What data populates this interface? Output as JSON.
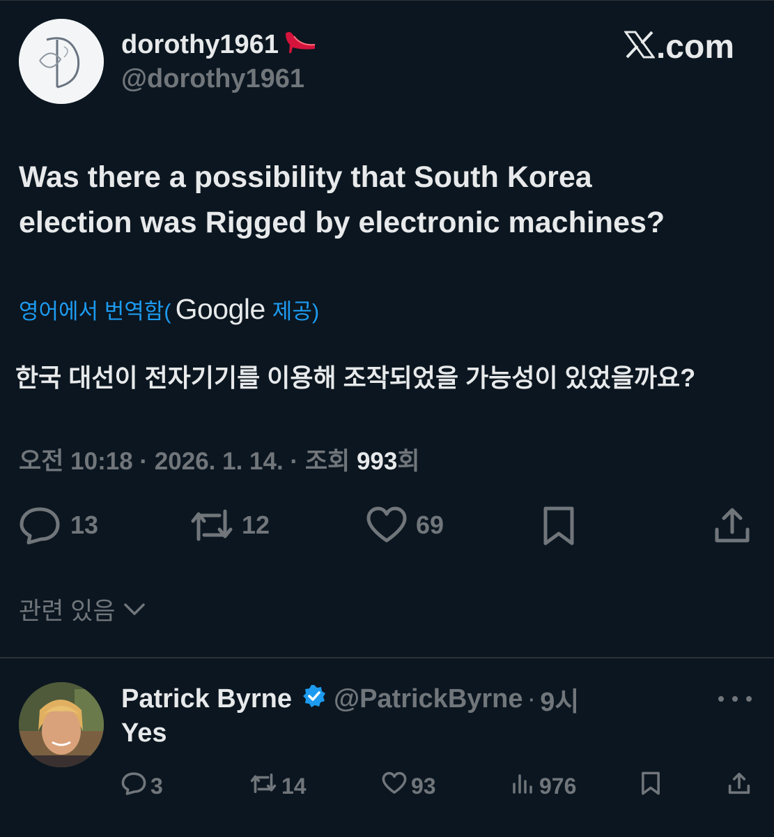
{
  "tweet": {
    "author_name": "dorothy1961",
    "author_emoji": "👠",
    "author_handle": "@dorothy1961",
    "site_brand": ".com",
    "text_line1": "Was there a possibility that South Korea",
    "text_line2": "election was Rigged by electronic machines?",
    "translation_label": "영어에서 번역함(",
    "translation_provider": "Google",
    "translation_suffix": "제공)",
    "translated_text": "한국 대선이 전자기기를 이용해 조작되었을 가능성이 있었을까요?",
    "time_prefix": "오전",
    "time": "10:18",
    "date": "2026. 1. 14.",
    "views_label": "조회",
    "views_count": "993",
    "views_suffix": "회",
    "replies": "13",
    "retweets": "12",
    "likes": "69",
    "related_label": "관련 있음"
  },
  "reply": {
    "author_name": "Patrick Byrne",
    "author_handle": "@PatrickByrne",
    "time_ago": "9시",
    "text": "Yes",
    "replies": "3",
    "retweets": "14",
    "likes": "93",
    "views": "976"
  },
  "colors": {
    "background": "#0b1620",
    "text_primary": "#e7e9ea",
    "text_secondary": "#71767b",
    "accent": "#1d9bf0",
    "stiletto": "#e0245e"
  },
  "icons": {
    "reply": "reply-icon",
    "retweet": "retweet-icon",
    "like": "heart-icon",
    "bookmark": "bookmark-icon",
    "share": "share-icon",
    "views": "views-icon",
    "more": "more-icon",
    "verified": "verified-badge-icon",
    "chevron": "chevron-down-icon",
    "x_logo": "x-logo-icon"
  }
}
